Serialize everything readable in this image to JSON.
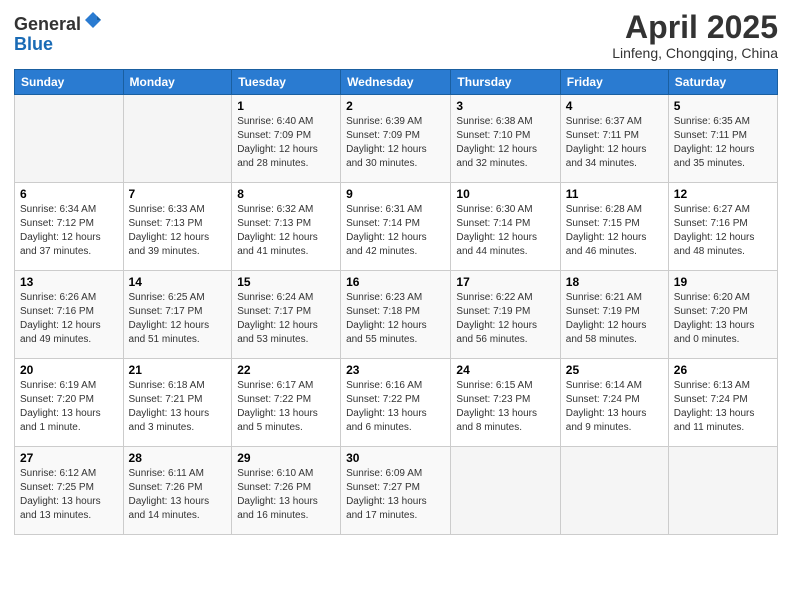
{
  "header": {
    "logo_line1": "General",
    "logo_line2": "Blue",
    "month_title": "April 2025",
    "location": "Linfeng, Chongqing, China"
  },
  "days_of_week": [
    "Sunday",
    "Monday",
    "Tuesday",
    "Wednesday",
    "Thursday",
    "Friday",
    "Saturday"
  ],
  "weeks": [
    [
      {
        "day": "",
        "info": ""
      },
      {
        "day": "",
        "info": ""
      },
      {
        "day": "1",
        "info": "Sunrise: 6:40 AM\nSunset: 7:09 PM\nDaylight: 12 hours\nand 28 minutes."
      },
      {
        "day": "2",
        "info": "Sunrise: 6:39 AM\nSunset: 7:09 PM\nDaylight: 12 hours\nand 30 minutes."
      },
      {
        "day": "3",
        "info": "Sunrise: 6:38 AM\nSunset: 7:10 PM\nDaylight: 12 hours\nand 32 minutes."
      },
      {
        "day": "4",
        "info": "Sunrise: 6:37 AM\nSunset: 7:11 PM\nDaylight: 12 hours\nand 34 minutes."
      },
      {
        "day": "5",
        "info": "Sunrise: 6:35 AM\nSunset: 7:11 PM\nDaylight: 12 hours\nand 35 minutes."
      }
    ],
    [
      {
        "day": "6",
        "info": "Sunrise: 6:34 AM\nSunset: 7:12 PM\nDaylight: 12 hours\nand 37 minutes."
      },
      {
        "day": "7",
        "info": "Sunrise: 6:33 AM\nSunset: 7:13 PM\nDaylight: 12 hours\nand 39 minutes."
      },
      {
        "day": "8",
        "info": "Sunrise: 6:32 AM\nSunset: 7:13 PM\nDaylight: 12 hours\nand 41 minutes."
      },
      {
        "day": "9",
        "info": "Sunrise: 6:31 AM\nSunset: 7:14 PM\nDaylight: 12 hours\nand 42 minutes."
      },
      {
        "day": "10",
        "info": "Sunrise: 6:30 AM\nSunset: 7:14 PM\nDaylight: 12 hours\nand 44 minutes."
      },
      {
        "day": "11",
        "info": "Sunrise: 6:28 AM\nSunset: 7:15 PM\nDaylight: 12 hours\nand 46 minutes."
      },
      {
        "day": "12",
        "info": "Sunrise: 6:27 AM\nSunset: 7:16 PM\nDaylight: 12 hours\nand 48 minutes."
      }
    ],
    [
      {
        "day": "13",
        "info": "Sunrise: 6:26 AM\nSunset: 7:16 PM\nDaylight: 12 hours\nand 49 minutes."
      },
      {
        "day": "14",
        "info": "Sunrise: 6:25 AM\nSunset: 7:17 PM\nDaylight: 12 hours\nand 51 minutes."
      },
      {
        "day": "15",
        "info": "Sunrise: 6:24 AM\nSunset: 7:17 PM\nDaylight: 12 hours\nand 53 minutes."
      },
      {
        "day": "16",
        "info": "Sunrise: 6:23 AM\nSunset: 7:18 PM\nDaylight: 12 hours\nand 55 minutes."
      },
      {
        "day": "17",
        "info": "Sunrise: 6:22 AM\nSunset: 7:19 PM\nDaylight: 12 hours\nand 56 minutes."
      },
      {
        "day": "18",
        "info": "Sunrise: 6:21 AM\nSunset: 7:19 PM\nDaylight: 12 hours\nand 58 minutes."
      },
      {
        "day": "19",
        "info": "Sunrise: 6:20 AM\nSunset: 7:20 PM\nDaylight: 13 hours\nand 0 minutes."
      }
    ],
    [
      {
        "day": "20",
        "info": "Sunrise: 6:19 AM\nSunset: 7:20 PM\nDaylight: 13 hours\nand 1 minute."
      },
      {
        "day": "21",
        "info": "Sunrise: 6:18 AM\nSunset: 7:21 PM\nDaylight: 13 hours\nand 3 minutes."
      },
      {
        "day": "22",
        "info": "Sunrise: 6:17 AM\nSunset: 7:22 PM\nDaylight: 13 hours\nand 5 minutes."
      },
      {
        "day": "23",
        "info": "Sunrise: 6:16 AM\nSunset: 7:22 PM\nDaylight: 13 hours\nand 6 minutes."
      },
      {
        "day": "24",
        "info": "Sunrise: 6:15 AM\nSunset: 7:23 PM\nDaylight: 13 hours\nand 8 minutes."
      },
      {
        "day": "25",
        "info": "Sunrise: 6:14 AM\nSunset: 7:24 PM\nDaylight: 13 hours\nand 9 minutes."
      },
      {
        "day": "26",
        "info": "Sunrise: 6:13 AM\nSunset: 7:24 PM\nDaylight: 13 hours\nand 11 minutes."
      }
    ],
    [
      {
        "day": "27",
        "info": "Sunrise: 6:12 AM\nSunset: 7:25 PM\nDaylight: 13 hours\nand 13 minutes."
      },
      {
        "day": "28",
        "info": "Sunrise: 6:11 AM\nSunset: 7:26 PM\nDaylight: 13 hours\nand 14 minutes."
      },
      {
        "day": "29",
        "info": "Sunrise: 6:10 AM\nSunset: 7:26 PM\nDaylight: 13 hours\nand 16 minutes."
      },
      {
        "day": "30",
        "info": "Sunrise: 6:09 AM\nSunset: 7:27 PM\nDaylight: 13 hours\nand 17 minutes."
      },
      {
        "day": "",
        "info": ""
      },
      {
        "day": "",
        "info": ""
      },
      {
        "day": "",
        "info": ""
      }
    ]
  ]
}
